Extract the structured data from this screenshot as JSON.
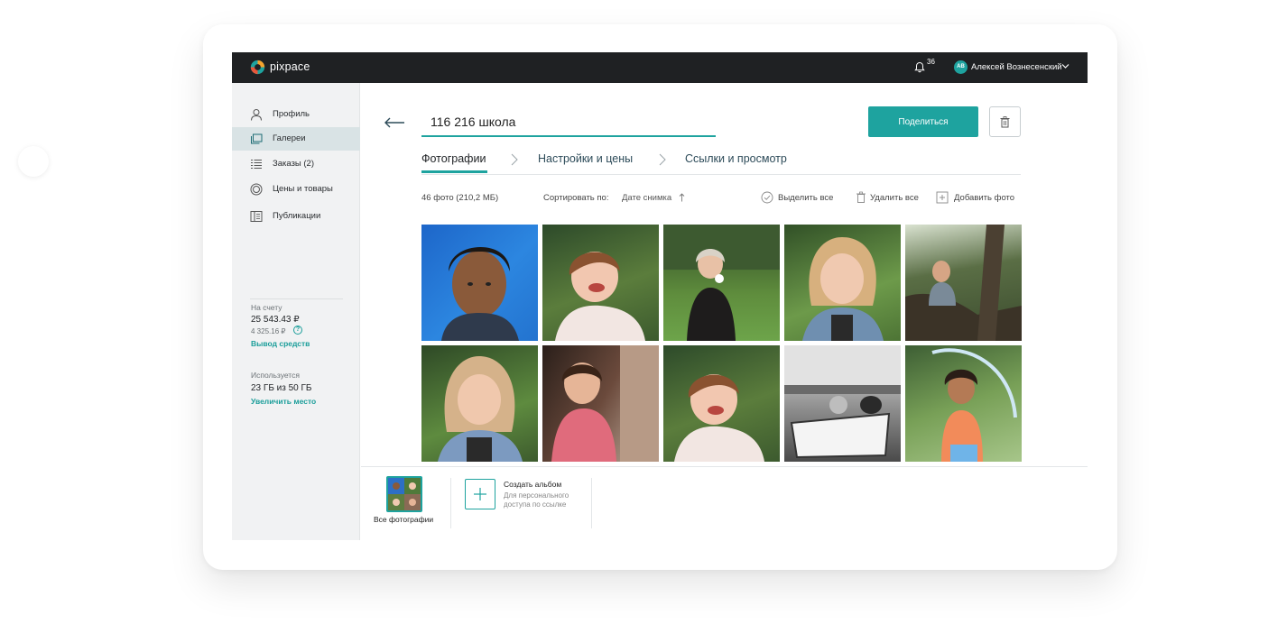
{
  "app": {
    "brand": "pixpace",
    "notifications_count": "36",
    "user_initials": "АВ",
    "user_name": "Алексей Вознесенский"
  },
  "sidebar": {
    "items": [
      {
        "label": "Профиль",
        "icon": "user-icon",
        "active": false
      },
      {
        "label": "Галереи",
        "icon": "gallery-icon",
        "active": true
      },
      {
        "label": "Заказы (2)",
        "icon": "list-icon",
        "active": false
      },
      {
        "label": "Цены и товары",
        "icon": "rings-icon",
        "active": false
      },
      {
        "label": "Публикации",
        "icon": "book-icon",
        "active": false
      }
    ],
    "balance": {
      "label": "На счету",
      "amount": "25 543.43 ₽",
      "sub_amount": "4 325.16 ₽",
      "help": "?",
      "link": "Вывод средств"
    },
    "storage": {
      "label": "Используется",
      "value": "23 ГБ из 50 ГБ",
      "link": "Увеличить место"
    }
  },
  "gallery": {
    "title": "116 216 школа",
    "share_label": "Поделиться"
  },
  "tabs": [
    {
      "label": "Фотографии",
      "active": true
    },
    {
      "label": "Настройки и цены",
      "active": false
    },
    {
      "label": "Ссылки и просмотр",
      "active": false
    }
  ],
  "toolbar": {
    "count": "46 фото (210,2 МБ)",
    "sort_label": "Сортировать по:",
    "sort_value": "Дате снимка",
    "select_all": "Выделить все",
    "delete_all": "Удалить все",
    "add_photo": "Добавить фото"
  },
  "albums": {
    "all_label": "Все фотографии",
    "create_title": "Создать альбом",
    "create_sub": "Для персонального доступа по ссылке"
  },
  "colors": {
    "accent": "#1ea39f",
    "topbar": "#1f2123",
    "sidebar": "#f1f2f3",
    "sidebar_active": "#d9e3e5"
  }
}
